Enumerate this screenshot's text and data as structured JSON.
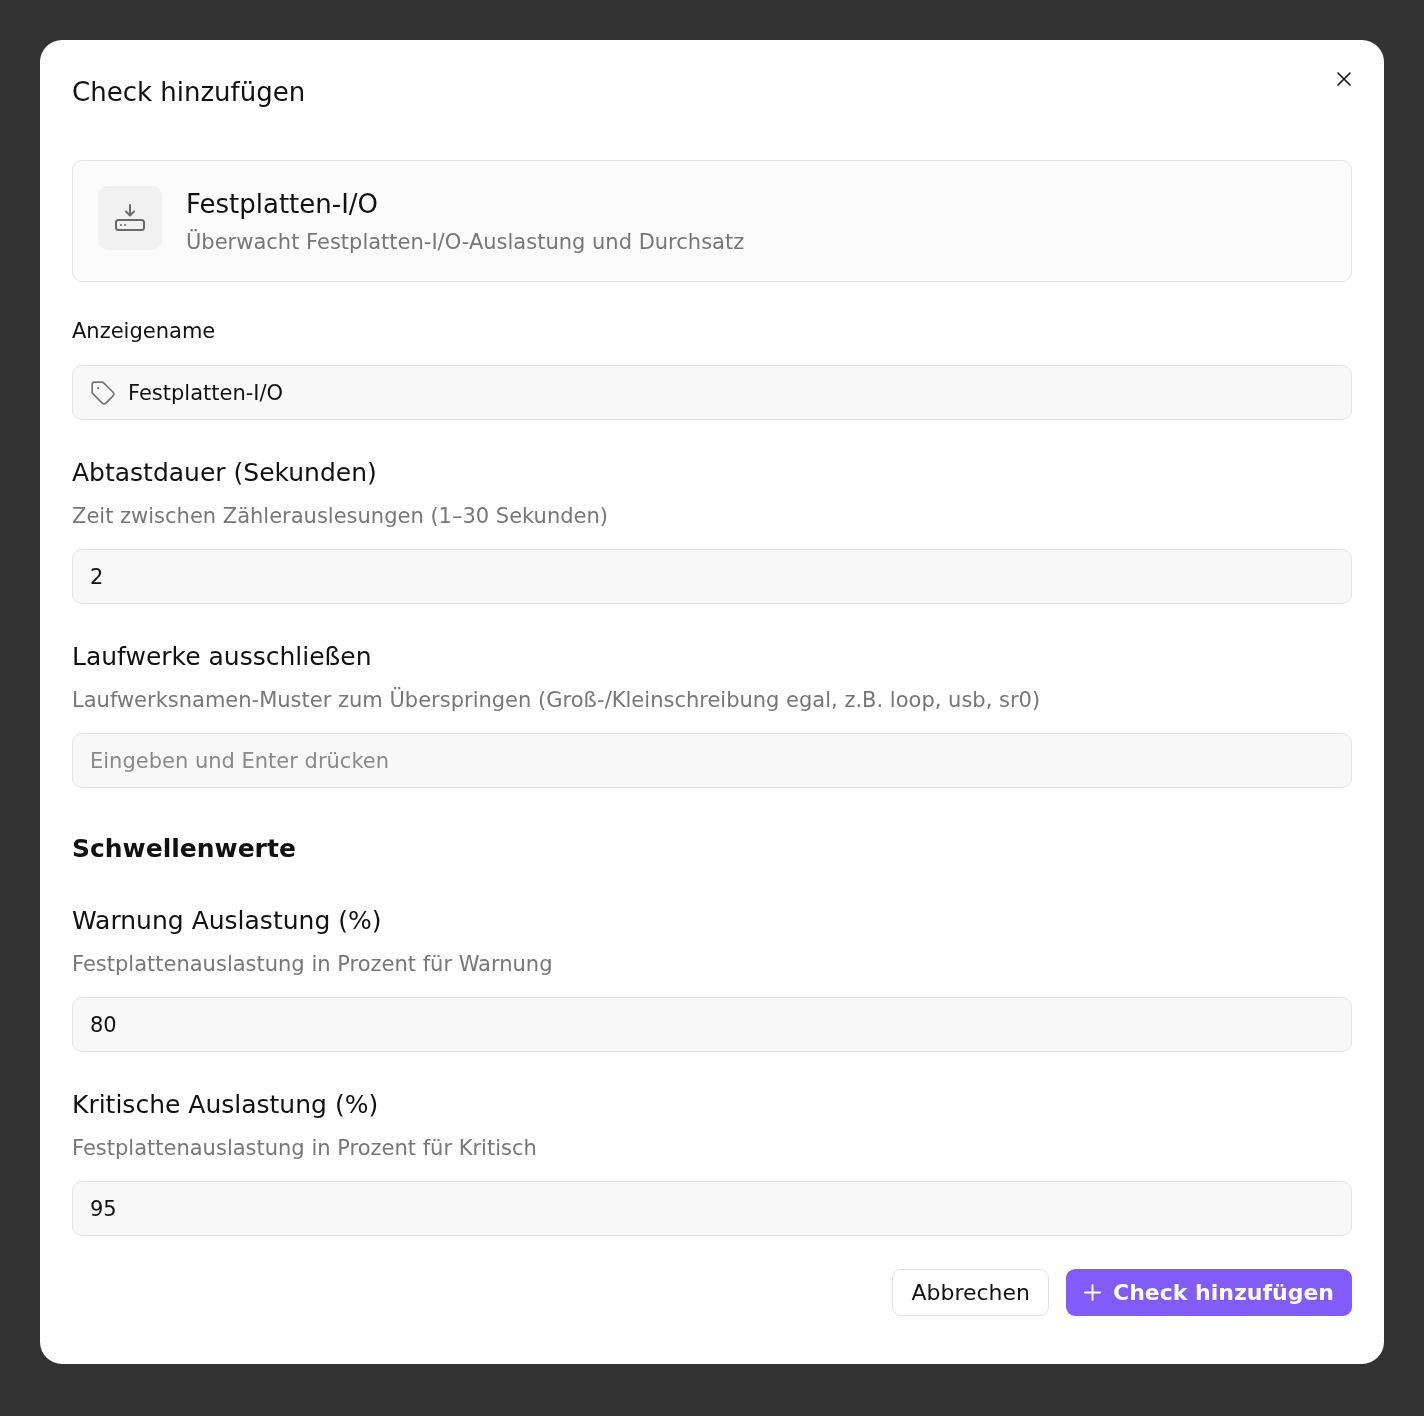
{
  "dialog": {
    "title": "Check hinzufügen"
  },
  "check_card": {
    "name": "Festplatten-I/O",
    "description": "Überwacht Festplatten-I/O-Auslastung und Durchsatz"
  },
  "display_name": {
    "label": "Anzeigename",
    "value": "Festplatten-I/O"
  },
  "settings": [
    {
      "label": "Abtastdauer (Sekunden)",
      "description": "Zeit zwischen Zählerauslesungen (1–30 Sekunden)",
      "value": "2"
    },
    {
      "label": "Laufwerke ausschließen",
      "description": "Laufwerksnamen-Muster zum Überspringen (Groß-/Kleinschreibung egal, z.B. loop, usb, sr0)",
      "placeholder": "Eingeben und Enter drücken"
    }
  ],
  "thresholds": {
    "heading": "Schwellenwerte",
    "settings": [
      {
        "label": "Warnung Auslastung (%)",
        "description": "Festplattenauslastung in Prozent für Warnung",
        "value": "80"
      },
      {
        "label": "Kritische Auslastung (%)",
        "description": "Festplattenauslastung in Prozent für Kritisch",
        "value": "95"
      }
    ]
  },
  "buttons": [
    {
      "kind": "secondary",
      "label": "Abbrechen"
    },
    {
      "kind": "primary",
      "label": "Check hinzufügen"
    }
  ]
}
